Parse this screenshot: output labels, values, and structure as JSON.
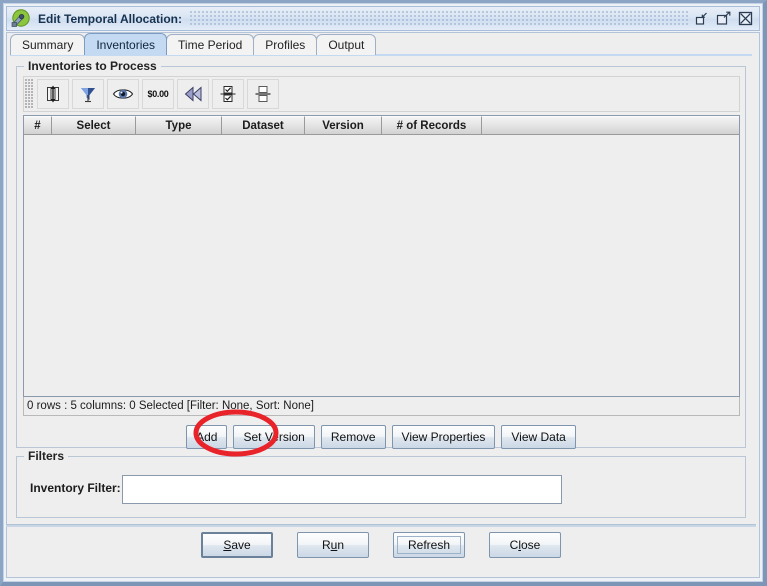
{
  "window": {
    "title": "Edit Temporal Allocation:",
    "app_icon": "app-icon",
    "controls": [
      {
        "name": "minimize-button",
        "icon": "minimize-icon"
      },
      {
        "name": "maximize-button",
        "icon": "maximize-icon"
      },
      {
        "name": "close-button",
        "icon": "close-icon"
      }
    ]
  },
  "tabs": [
    {
      "label": "Summary",
      "selected": false
    },
    {
      "label": "Inventories",
      "selected": true
    },
    {
      "label": "Time Period",
      "selected": false
    },
    {
      "label": "Profiles",
      "selected": false
    },
    {
      "label": "Output",
      "selected": false
    }
  ],
  "inventories_group": {
    "title": "Inventories to Process",
    "toolbar": [
      {
        "name": "sort-columns-button",
        "icon": "column-sort-icon",
        "tooltip": "Sort"
      },
      {
        "name": "filter-button",
        "icon": "funnel-icon",
        "tooltip": "Filter"
      },
      {
        "name": "show-hide-columns-button",
        "icon": "eye-icon",
        "tooltip": "Show/Hide Columns"
      },
      {
        "name": "format-button",
        "icon": "money-icon",
        "label": "$0.00",
        "tooltip": "Format"
      },
      {
        "name": "reset-button",
        "icon": "rewind-icon",
        "tooltip": "Reset"
      },
      {
        "name": "select-all-button",
        "icon": "checkbox-pair-icon",
        "tooltip": "Select"
      },
      {
        "name": "split-view-button",
        "icon": "split-box-icon",
        "tooltip": "Split"
      }
    ],
    "table": {
      "columns": [
        "#",
        "Select",
        "Type",
        "Dataset",
        "Version",
        "# of Records"
      ],
      "rows": [],
      "status": "0 rows : 5 columns: 0 Selected [Filter: None, Sort: None]"
    },
    "buttons": [
      {
        "name": "add-button",
        "label": "Add"
      },
      {
        "name": "set-version-button",
        "label": "Set Version"
      },
      {
        "name": "remove-button",
        "label": "Remove"
      },
      {
        "name": "view-properties-button",
        "label": "View Properties"
      },
      {
        "name": "view-data-button",
        "label": "View Data"
      }
    ]
  },
  "filters_group": {
    "title": "Filters",
    "inventory_filter": {
      "label": "Inventory Filter:",
      "value": "",
      "placeholder": ""
    }
  },
  "bottom_buttons": [
    {
      "name": "save-button",
      "label": "Save",
      "mnemonic": "S",
      "pre": "",
      "post": "ave",
      "default": true,
      "focused": false
    },
    {
      "name": "run-button",
      "label": "Run",
      "mnemonic": "u",
      "pre": "R",
      "post": "n",
      "default": false,
      "focused": false
    },
    {
      "name": "refresh-button",
      "label": "Refresh",
      "mnemonic": "",
      "pre": "Refresh",
      "post": "",
      "default": false,
      "focused": true
    },
    {
      "name": "close-button-bottom",
      "label": "Close",
      "mnemonic": "l",
      "pre": "C",
      "post": "ose",
      "default": false,
      "focused": false
    }
  ],
  "annotation": {
    "shape": "ellipse",
    "color": "#e8232a",
    "target": "Add",
    "stroke_width": 5
  },
  "colors": {
    "selected_tab": "#c3daf2",
    "title_bar": "#dbe6f4",
    "frame_border": "#8da5c4",
    "panel_bg": "#eeeeee",
    "annotation_red": "#e8232a"
  }
}
